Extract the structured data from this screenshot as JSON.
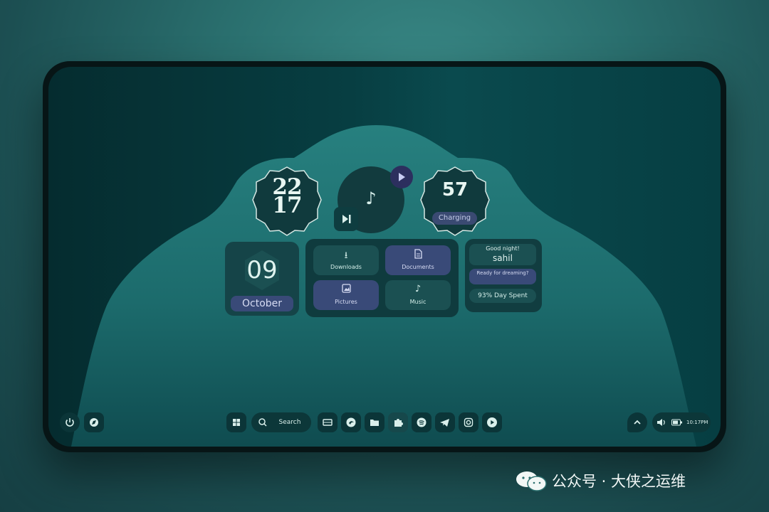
{
  "colors": {
    "accent": "#1b5052",
    "secondary": "#394a78",
    "screen_bg": "#073e42",
    "text": "#dff3ef"
  },
  "clock_widget": {
    "hours": "22",
    "minutes": "17"
  },
  "music_widget": {
    "note_icon": "music-note-icon",
    "play_icon": "play-icon",
    "skip_icon": "skip-next-icon"
  },
  "battery_widget": {
    "percent": "57",
    "status": "Charging"
  },
  "date_widget": {
    "day": "09",
    "month": "October"
  },
  "files_widget": {
    "items": [
      {
        "label": "Downloads",
        "icon": "download-icon"
      },
      {
        "label": "Documents",
        "icon": "document-icon"
      },
      {
        "label": "Pictures",
        "icon": "image-icon"
      },
      {
        "label": "Music",
        "icon": "music-note-icon"
      }
    ]
  },
  "greeting_widget": {
    "greeting": "Good night!",
    "name": "sahil",
    "message": "Ready for dreaming?",
    "day_spent": "93% Day Spent"
  },
  "taskbar": {
    "search_label": "Search",
    "left_icons": [
      "power-icon",
      "compass-icon"
    ],
    "apps": [
      "windows-start-icon",
      "video-icon",
      "edge-icon",
      "files-icon",
      "puzzle-icon",
      "spotify-icon",
      "telegram-icon",
      "instagram-icon",
      "youtube-icon"
    ],
    "chevron_icon": "chevron-up-icon",
    "time": "10:17PM"
  },
  "watermark": {
    "text": "公众号 · 大侠之运维"
  }
}
